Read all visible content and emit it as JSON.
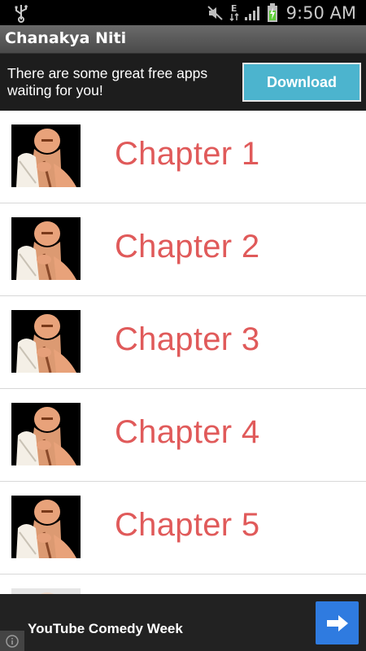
{
  "status_bar": {
    "time": "9:50 AM",
    "network_type": "E",
    "icons": [
      "usb-icon",
      "mute-icon",
      "data-network-icon",
      "signal-icon",
      "battery-charging-icon"
    ]
  },
  "action_bar": {
    "title": "Chanakya Niti"
  },
  "top_ad": {
    "message": "There are some great free apps waiting for you!",
    "button_label": "Download"
  },
  "chapters": [
    {
      "label": "Chapter 1"
    },
    {
      "label": "Chapter 2"
    },
    {
      "label": "Chapter 3"
    },
    {
      "label": "Chapter 4"
    },
    {
      "label": "Chapter 5"
    }
  ],
  "bottom_ad": {
    "text": "YouTube Comedy Week",
    "button_icon": "arrow-right-icon",
    "info_icon": "info-icon"
  },
  "colors": {
    "chapter_text": "#e05a5a",
    "download_button": "#4cb4ce",
    "ad_arrow_button": "#2f7be0"
  }
}
